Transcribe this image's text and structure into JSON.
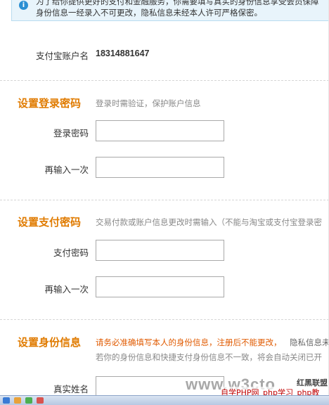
{
  "notice": {
    "icon": "info-icon",
    "line1": "为了给你提供更好的支付和金融服务，你需要填写真实的身份信息享受会员保障",
    "line2": "身份信息一经录入不可更改，隐私信息未经本人许可严格保密。"
  },
  "account": {
    "label": "支付宝账户名",
    "value": "18314881647"
  },
  "login_password": {
    "title": "设置登录密码",
    "description": "登录时需验证，保护账户信息",
    "field_label": "登录密码",
    "confirm_label": "再输入一次"
  },
  "pay_password": {
    "title": "设置支付密码",
    "description": "交易付款或账户信息更改时需输入（不能与淘宝或支付宝登录密",
    "field_label": "支付密码",
    "confirm_label": "再输入一次"
  },
  "identity": {
    "title": "设置身份信息",
    "warning": "请务必准确填写本人的身份信息，注册后不能更改，",
    "warning_tail": "隐私信息未",
    "line2": "若你的身份信息和快捷支付身份信息不一致，将会自动关闭已开",
    "name_label": "真实姓名"
  },
  "watermark": {
    "big_text": "www.w3cto",
    "brand": "红黑联盟",
    "sub_text": "自学PHP网_php学习_php教"
  },
  "colors": {
    "section_title": "#e07b00",
    "warning": "#e05a00",
    "notice_bg": "#e8f4fb"
  }
}
